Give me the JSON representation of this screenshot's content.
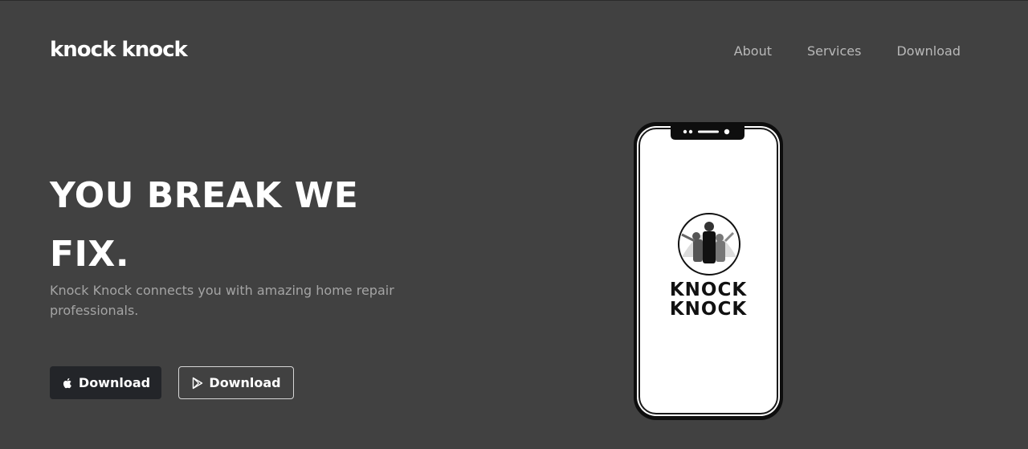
{
  "header": {
    "brand": "knock knock",
    "nav": [
      "About",
      "Services",
      "Download"
    ]
  },
  "hero": {
    "headline_line1": "YOU BREAK WE",
    "headline_line2": "FIX.",
    "subline": "Knock Knock connects you with amazing home repair professionals.",
    "buttons": {
      "app_store_label": "Download",
      "play_store_label": "Download"
    }
  },
  "phone": {
    "logo_line1": "KNOCK",
    "logo_line2": "KNOCK"
  },
  "colors": {
    "background": "#414141",
    "text_primary": "#ffffff",
    "text_muted": "#a4a4a4",
    "apple_button": "#232529"
  },
  "icons": {
    "apple": "apple-logo-icon",
    "play": "google-play-icon"
  }
}
